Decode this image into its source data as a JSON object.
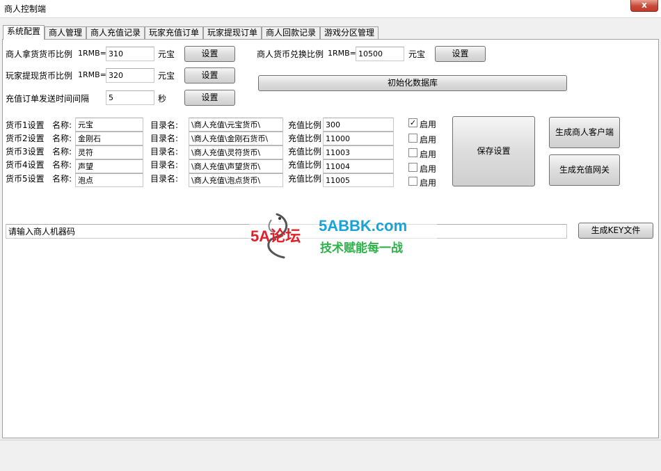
{
  "window": {
    "title": "商人控制端",
    "close_glyph": "x"
  },
  "tabs": [
    "系统配置",
    "商人管理",
    "商人充值记录",
    "玩家充值订单",
    "玩家提现订单",
    "商人回款记录",
    "游戏分区管理"
  ],
  "settings": {
    "merchant_ratio": {
      "label": "商人拿货货币比例",
      "prefix": "1RMB=",
      "value": "310",
      "unit": "元宝",
      "button": "设置"
    },
    "player_withdraw_ratio": {
      "label": "玩家提现货币比例",
      "prefix": "1RMB=",
      "value": "320",
      "unit": "元宝",
      "button": "设置"
    },
    "order_interval": {
      "label": "充值订单发送时间间隔",
      "value": "5",
      "unit": "秒",
      "button": "设置"
    },
    "exchange_ratio": {
      "label": "商人货币兑换比例",
      "prefix": "1RMB=",
      "value": "10500",
      "unit": "元宝",
      "button": "设置"
    },
    "init_db_button": "初始化数据库"
  },
  "currency_labels": {
    "name": "名称:",
    "dir": "目录名:",
    "ratio": "充值比例",
    "enable": "启用"
  },
  "currencies": [
    {
      "label": "货币1设置",
      "name": "元宝",
      "dir": "\\商人充值\\元宝货币\\",
      "ratio": "300",
      "enabled": true
    },
    {
      "label": "货币2设置",
      "name": "金刚石",
      "dir": "\\商人充值\\金刚石货币\\",
      "ratio": "11000",
      "enabled": false
    },
    {
      "label": "货币3设置",
      "name": "灵符",
      "dir": "\\商人充值\\灵符货币\\",
      "ratio": "11003",
      "enabled": false
    },
    {
      "label": "货币4设置",
      "name": "声望",
      "dir": "\\商人充值\\声望货币\\",
      "ratio": "11004",
      "enabled": false
    },
    {
      "label": "货币5设置",
      "name": "泡点",
      "dir": "\\商人充值\\泡点货币\\",
      "ratio": "11005",
      "enabled": false
    }
  ],
  "actions": {
    "save": "保存设置",
    "gen_client": "生成商人客户端",
    "gen_gateway": "生成充值网关",
    "machine_code": "请输入商人机器码",
    "gen_key": "生成KEY文件"
  },
  "watermark": {
    "brand": "5A论坛",
    "domain": "5ABBK.com",
    "slogan": "技术赋能每一战"
  },
  "colors": {
    "panel": "#ffffff",
    "window": "#f0f0f0",
    "close": "#c74a38",
    "watermark_red": "#e0202a",
    "watermark_cyan": "#1aa3d6",
    "watermark_green": "#2db34a"
  }
}
